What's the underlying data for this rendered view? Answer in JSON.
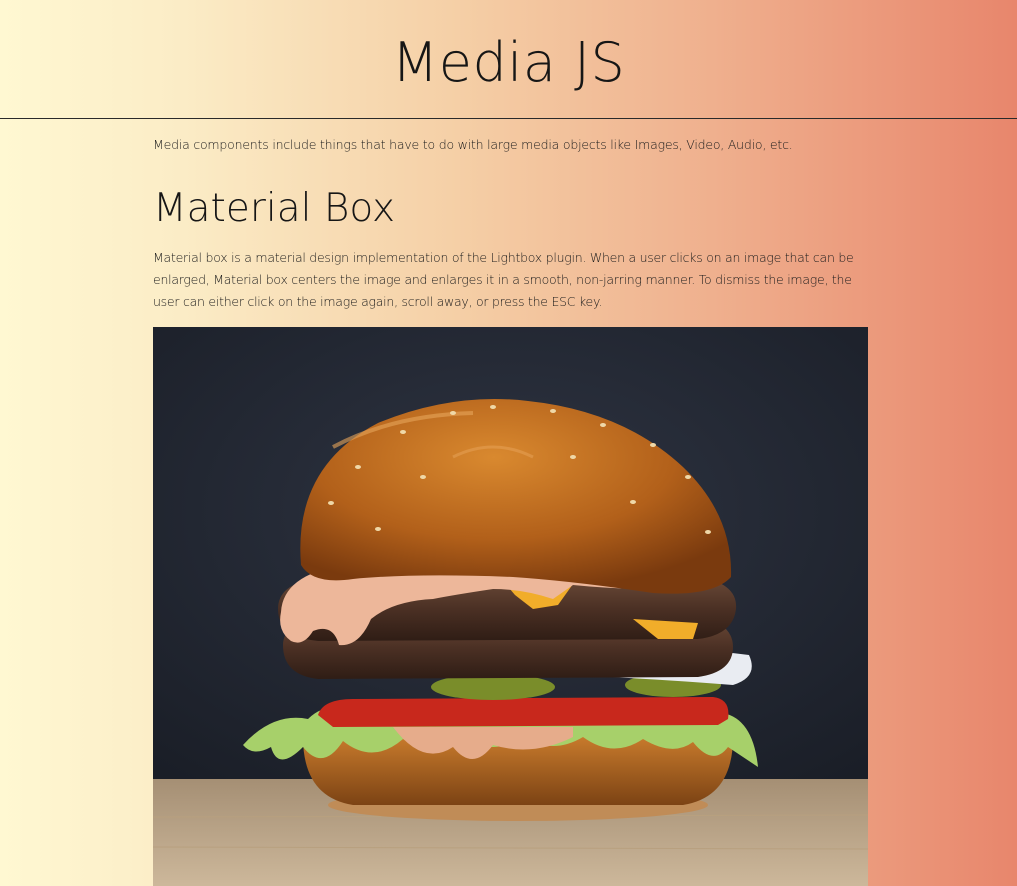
{
  "header": {
    "title": "Media JS"
  },
  "content": {
    "intro": "Media components include things that have to do with large media objects like Images, Video, Audio, etc.",
    "section_title": "Material Box",
    "description": "Material box is a material design implementation of the Lightbox plugin. When a user clicks on an image that can be enlarged, Material box centers the image and enlarges it in a smooth, non-jarring manner. To dismiss the image, the user can either click on the image again, scroll away, or press the ESC key."
  },
  "image": {
    "subject": "burger-photo"
  },
  "colors": {
    "gradient_start": "#fff8d2",
    "gradient_end": "#e8866c",
    "text": "#1c1c1c"
  }
}
